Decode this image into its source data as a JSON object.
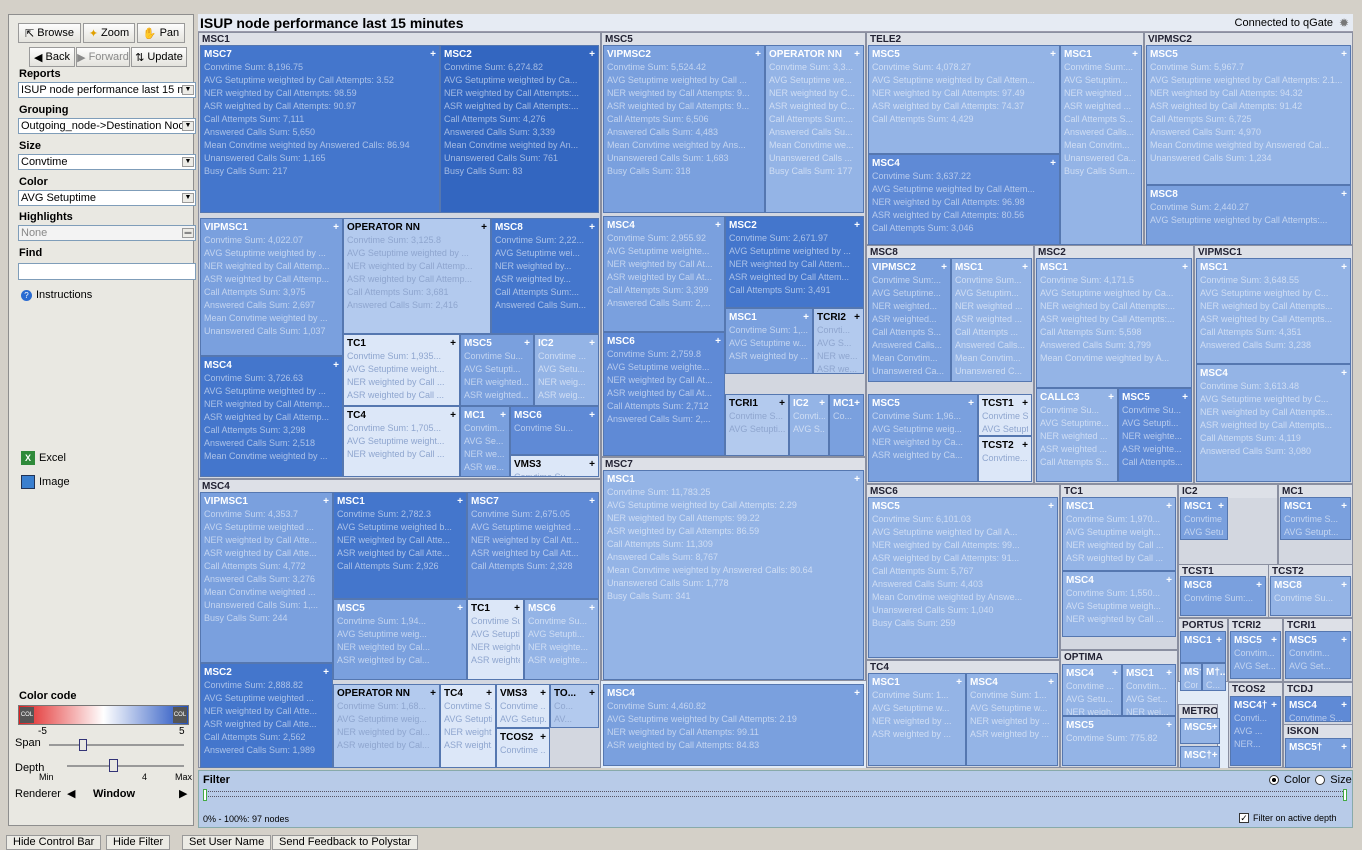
{
  "controls": {
    "browse": "Browse",
    "zoom": "Zoom",
    "pan": "Pan",
    "back": "Back",
    "forward": "Forward",
    "update": "Update",
    "reports_label": "Reports",
    "reports_value": "ISUP node performance last 15 mi",
    "grouping_label": "Grouping",
    "grouping_value": "Outgoing_node->Destination Nod",
    "size_label": "Size",
    "size_value": "Convtime",
    "color_label": "Color",
    "color_value": "AVG Setuptime",
    "highlights_label": "Highlights",
    "highlights_value": "None",
    "find_label": "Find",
    "find_value": "",
    "instructions": "Instructions",
    "excel": "Excel",
    "image": "Image",
    "color_code_label": "Color code",
    "cc_min": "-5",
    "cc_max": "5",
    "span_label": "Span",
    "depth_label": "Depth",
    "depth_min": "Min",
    "depth_val": "4",
    "depth_max": "Max",
    "renderer_label": "Renderer",
    "renderer_value": "Window"
  },
  "treemap": {
    "title": "ISUP node performance last 15 minutes",
    "connection": "Connected to qGate",
    "groups": [
      {
        "name": "MSC1"
      },
      {
        "name": "MSC5"
      },
      {
        "name": "TELE2"
      },
      {
        "name": "VIPMSC2"
      },
      {
        "name": "MSC8"
      },
      {
        "name": "MSC2"
      },
      {
        "name": "VIPMSC1"
      },
      {
        "name": "MSC7"
      },
      {
        "name": "MSC4"
      },
      {
        "name": "MSC6"
      },
      {
        "name": "TC1"
      },
      {
        "name": "IC2"
      },
      {
        "name": "MC1"
      },
      {
        "name": "TC4"
      },
      {
        "name": "OPTIMA"
      },
      {
        "name": "TCST1"
      },
      {
        "name": "TCST2"
      },
      {
        "name": "PORTUS"
      },
      {
        "name": "TCRI2"
      },
      {
        "name": "TCRI1"
      },
      {
        "name": "METRO"
      },
      {
        "name": "TCOS2"
      },
      {
        "name": "TCDJ"
      },
      {
        "name": "ISKON"
      }
    ],
    "cells": [
      {
        "name": "MSC7",
        "lines": [
          "Convtime Sum: 8,196.75",
          "AVG Setuptime weighted by Call Attempts: 3.52",
          "NER weighted by Call Attempts: 98.59",
          "ASR weighted by Call Attempts: 90.97",
          "Call Attempts Sum: 7,111",
          "Answered Calls Sum: 5,650",
          "Mean Convtime weighted by Answered Calls: 86.94",
          "Unanswered Calls Sum: 1,165",
          "Busy Calls Sum: 217"
        ]
      },
      {
        "name": "MSC2",
        "lines": [
          "Convtime Sum: 6,274.82",
          "AVG Setuptime weighted by Ca...",
          "NER weighted by Call Attempts:...",
          "ASR weighted by Call Attempts:...",
          "Call Attempts Sum: 4,276",
          "Answered Calls Sum: 3,339",
          "Mean Convtime weighted by An...",
          "Unanswered Calls Sum: 761",
          "Busy Calls Sum: 83"
        ]
      },
      {
        "name": "VIPMSC2",
        "lines": [
          "Convtime Sum: 5,524.42",
          "AVG Setuptime weighted by Call ...",
          "NER weighted by Call Attempts: 9...",
          "ASR weighted by Call Attempts: 9...",
          "Call Attempts Sum: 6,506",
          "Answered Calls Sum: 4,483",
          "Mean Convtime weighted by Ans...",
          "Unanswered Calls Sum: 1,683",
          "Busy Calls Sum: 318"
        ]
      },
      {
        "name": "OPERATOR NN",
        "lines": [
          "Convtime Sum: 3,3...",
          "AVG Setuptime we...",
          "NER weighted by C...",
          "ASR weighted by C...",
          "Call Attempts Sum:...",
          "Answered Calls Su...",
          "Mean Convtime we...",
          "Unanswered Calls ...",
          "Busy Calls Sum: 177"
        ]
      },
      {
        "name": "MSC5",
        "lines": [
          "Convtime Sum: 4,078.27",
          "AVG Setuptime weighted by Call Attem...",
          "NER weighted by Call Attempts: 97.49",
          "ASR weighted by Call Attempts: 74.37",
          "Call Attempts Sum: 4,429"
        ]
      },
      {
        "name": "MSC1",
        "lines": [
          "Convtime Sum:...",
          "AVG Setuptim...",
          "NER weighted ...",
          "ASR weighted ...",
          "Call Attempts S...",
          "Answered Calls...",
          "Mean Convtim...",
          "Unanswered Ca...",
          "Busy Calls Sum..."
        ]
      },
      {
        "name": "MSC4",
        "lines": [
          "Convtime Sum: 3,637.22",
          "AVG Setuptime weighted by Call Attem...",
          "NER weighted by Call Attempts: 96.98",
          "ASR weighted by Call Attempts: 80.56",
          "Call Attempts Sum: 3,046"
        ]
      },
      {
        "name": "MSC5",
        "lines": [
          "Convtime Sum: 5,967.7",
          "AVG Setuptime weighted by Call Attempts: 2.1...",
          "NER weighted by Call Attempts: 94.32",
          "ASR weighted by Call Attempts: 91.42",
          "Call Attempts Sum: 6,725",
          "Answered Calls Sum: 4,970",
          "Mean Convtime weighted by Answered Cal...",
          "Unanswered Calls Sum: 1,234"
        ]
      },
      {
        "name": "MSC8",
        "lines": [
          "Convtime Sum: 2,440.27",
          "AVG Setuptime weighted by Call Attempts:..."
        ]
      },
      {
        "name": "VIPMSC1",
        "lines": [
          "Convtime Sum: 4,022.07",
          "AVG Setuptime weighted by ...",
          "NER weighted by Call Attemp...",
          "ASR weighted by Call Attemp...",
          "Call Attempts Sum: 3,975",
          "Answered Calls Sum: 2,697",
          "Mean Convtime weighted by ...",
          "Unanswered Calls Sum: 1,037"
        ]
      },
      {
        "name": "OPERATOR NN",
        "lines": [
          "Convtime Sum: 3,125.8",
          "AVG Setuptime weighted by ...",
          "NER weighted by Call Attemp...",
          "ASR weighted by Call Attemp...",
          "Call Attempts Sum: 3,681",
          "Answered Calls Sum: 2,416"
        ]
      },
      {
        "name": "MSC8",
        "lines": [
          "Convtime Sum: 2,22...",
          "AVG Setuptime wei...",
          "NER weighted by...",
          "ASR weighted by...",
          "Call Attempts Sum:...",
          "Answered Calls Sum..."
        ]
      },
      {
        "name": "MSC4",
        "lines": [
          "Convtime Sum: 3,726.63",
          "AVG Setuptime weighted by ...",
          "NER weighted by Call Attemp...",
          "ASR weighted by Call Attemp...",
          "Call Attempts Sum: 3,298",
          "Answered Calls Sum: 2,518",
          "Mean Convtime weighted by ..."
        ]
      },
      {
        "name": "TC1",
        "lines": [
          "Convtime Sum: 1,935...",
          "AVG Setuptime weight...",
          "NER weighted by Call ...",
          "ASR weighted by Call ..."
        ]
      },
      {
        "name": "MSC5",
        "lines": [
          "Convtime Su...",
          "AVG Setupti...",
          "NER weighted...",
          "ASR weighted..."
        ]
      },
      {
        "name": "IC2",
        "lines": [
          "Convtime ...",
          "AVG Setu...",
          "NER weig...",
          "ASR weig..."
        ]
      },
      {
        "name": "TC4",
        "lines": [
          "Convtime Sum: 1,705...",
          "AVG Setuptime weight...",
          "NER weighted by Call ..."
        ]
      },
      {
        "name": "MC1",
        "lines": [
          "Convtim...",
          "AVG Se...",
          "NER we...",
          "ASR we..."
        ]
      },
      {
        "name": "MSC6",
        "lines": [
          "Convtime Su..."
        ]
      },
      {
        "name": "VMS3",
        "lines": [
          "Convtime Su..."
        ]
      },
      {
        "name": "MSC4",
        "lines": [
          "Convtime Sum: 2,955.92",
          "AVG Setuptime weighte...",
          "NER weighted by Call At...",
          "ASR weighted by Call At...",
          "Call Attempts Sum: 3,399",
          "Answered Calls Sum: 2,..."
        ]
      },
      {
        "name": "MSC2",
        "lines": [
          "Convtime Sum: 2,671.97",
          "AVG Setuptime weighted by ...",
          "NER weighted by Call Attem...",
          "ASR weighted by Call Attem...",
          "Call Attempts Sum: 3,491"
        ]
      },
      {
        "name": "MSC6",
        "lines": [
          "Convtime Sum: 2,759.8",
          "AVG Setuptime weighte...",
          "NER weighted by Call At...",
          "ASR weighted by Call At...",
          "Call Attempts Sum: 2,712",
          "Answered Calls Sum: 2,..."
        ]
      },
      {
        "name": "MSC1",
        "lines": [
          "Convtime Sum: 1,...",
          "AVG Setuptime w...",
          "ASR weighted by ..."
        ]
      },
      {
        "name": "TCRI2",
        "lines": [
          "Convti...",
          "AVG S...",
          "NER we...",
          "ASR we..."
        ]
      },
      {
        "name": "TCRI1",
        "lines": [
          "Convtime S...",
          "AVG Setupti..."
        ]
      },
      {
        "name": "IC2",
        "lines": [
          "Convti...",
          "AVG S..."
        ]
      },
      {
        "name": "MC1",
        "lines": [
          "Co..."
        ]
      },
      {
        "name": "MSC1",
        "lines": [
          "Convtime Sum: 11,783.25",
          "AVG Setuptime weighted by Call Attempts: 2.29",
          "NER weighted by Call Attempts: 99.22",
          "ASR weighted by Call Attempts: 86.59",
          "Call Attempts Sum: 11,309",
          "Answered Calls Sum: 8,767",
          "Mean Convtime weighted by Answered Calls: 80.64",
          "Unanswered Calls Sum: 1,778",
          "Busy Calls Sum: 341"
        ]
      },
      {
        "name": "MSC4",
        "lines": [
          "Convtime Sum: 4,460.82",
          "AVG Setuptime weighted by Call Attempts: 2.19",
          "NER weighted by Call Attempts: 99.11",
          "ASR weighted by Call Attempts: 84.83"
        ]
      },
      {
        "name": "VIPMSC2",
        "lines": [
          "Convtime Sum:...",
          "AVG Setuptime...",
          "NER weighted...",
          "ASR weighted...",
          "Call Attempts S...",
          "Answered Calls...",
          "Mean Convtim...",
          "Unanswered Ca..."
        ]
      },
      {
        "name": "MSC1",
        "lines": [
          "Convtime Sum...",
          "AVG Setuptim...",
          "NER weighted ...",
          "ASR weighted ...",
          "Call Attempts ...",
          "Answered Calls...",
          "Mean Convtim...",
          "Unanswered C..."
        ]
      },
      {
        "name": "MSC1",
        "lines": [
          "Convtime Sum: 4,171.5",
          "AVG Setuptime weighted by Ca...",
          "NER weighted by Call Attempts:...",
          "ASR weighted by Call Attempts:...",
          "Call Attempts Sum: 5,598",
          "Answered Calls Sum: 3,799",
          "Mean Convtime weighted by A..."
        ]
      },
      {
        "name": "MSC1",
        "lines": [
          "Convtime Sum: 3,648.55",
          "AVG Setuptime weighted by C...",
          "NER weighted by Call Attempts...",
          "ASR weighted by Call Attempts...",
          "Call Attempts Sum: 4,351",
          "Answered Calls Sum: 3,238"
        ]
      },
      {
        "name": "MSC4",
        "lines": [
          "Convtime Sum: 3,613.48",
          "AVG Setuptime weighted by C...",
          "NER weighted by Call Attempts...",
          "ASR weighted by Call Attempts...",
          "Call Attempts Sum: 4,119",
          "Answered Calls Sum: 3,080"
        ]
      },
      {
        "name": "MSC5",
        "lines": [
          "Convtime Sum: 1,96...",
          "AVG Setuptime weig...",
          "NER weighted by Ca...",
          "ASR weighted by Ca..."
        ]
      },
      {
        "name": "TCST1",
        "lines": [
          "Convtime Su...",
          "AVG Setupti...",
          "NER weighte..."
        ]
      },
      {
        "name": "TCST2",
        "lines": [
          "Convtime..."
        ]
      },
      {
        "name": "CALLC3",
        "lines": [
          "Convtime Su...",
          "AVG Setuptime...",
          "NER weighted ...",
          "ASR weighted ...",
          "Call Attempts S..."
        ]
      },
      {
        "name": "MSC5",
        "lines": [
          "Convtime Su...",
          "AVG Setupti...",
          "NER weighte...",
          "ASR weighte...",
          "Call Attempts..."
        ]
      },
      {
        "name": "VIPMSC1",
        "lines": [
          "Convtime Sum: 4,353.7",
          "AVG Setuptime weighted ...",
          "NER weighted by Call Atte...",
          "ASR weighted by Call Atte...",
          "Call Attempts Sum: 4,772",
          "Answered Calls Sum: 3,276",
          "Mean Convtime weighted ...",
          "Unanswered Calls Sum: 1,...",
          "Busy Calls Sum: 244"
        ]
      },
      {
        "name": "MSC1",
        "lines": [
          "Convtime Sum: 2,782.3",
          "AVG Setuptime weighted b...",
          "NER weighted by Call Atte...",
          "ASR weighted by Call Atte...",
          "Call Attempts Sum: 2,926"
        ]
      },
      {
        "name": "MSC7",
        "lines": [
          "Convtime Sum: 2,675.05",
          "AVG Setuptime weighted ...",
          "NER weighted by Call Att...",
          "ASR weighted by Call Att...",
          "Call Attempts Sum: 2,328"
        ]
      },
      {
        "name": "MSC2",
        "lines": [
          "Convtime Sum: 2,888.82",
          "AVG Setuptime weighted ...",
          "NER weighted by Call Atte...",
          "ASR weighted by Call Atte...",
          "Call Attempts Sum: 2,562",
          "Answered Calls Sum: 1,989"
        ]
      },
      {
        "name": "MSC5",
        "lines": [
          "Convtime Sum: 1,94...",
          "AVG Setuptime weig...",
          "NER weighted by Cal...",
          "ASR weighted by Cal..."
        ]
      },
      {
        "name": "TC1",
        "lines": [
          "Convtime Sum:...",
          "AVG Setuptime...",
          "NER weighted ...",
          "ASR weighted ..."
        ]
      },
      {
        "name": "MSC6",
        "lines": [
          "Convtime Su...",
          "AVG Setupti...",
          "NER weighte...",
          "ASR weighte..."
        ]
      },
      {
        "name": "OPERATOR NN",
        "lines": [
          "Convtime Sum: 1,68...",
          "AVG Setuptime weig...",
          "NER weighted by Cal...",
          "ASR weighted by Cal..."
        ]
      },
      {
        "name": "TC4",
        "lines": [
          "Convtime S...",
          "AVG Setupti...",
          "NER weight...",
          "ASR weight..."
        ]
      },
      {
        "name": "VMS3",
        "lines": [
          "Convtime ...",
          "AVG Setup...",
          "Convtime ..."
        ]
      },
      {
        "name": "TO...",
        "lines": [
          "Co...",
          "AV...",
          "NE...",
          "AS..."
        ]
      },
      {
        "name": "TCOS2",
        "lines": [
          "Convtime ..."
        ]
      },
      {
        "name": "MSC5",
        "lines": [
          "Convtime Sum: 6,101.03",
          "AVG Setuptime weighted by Call A...",
          "NER weighted by Call Attempts: 99...",
          "ASR weighted by Call Attempts: 91...",
          "Call Attempts Sum: 5,767",
          "Answered Calls Sum: 4,403",
          "Mean Convtime weighted by Answe...",
          "Unanswered Calls Sum: 1,040",
          "Busy Calls Sum: 259"
        ]
      },
      {
        "name": "MSC1",
        "lines": [
          "Convtime Sum: 1,970...",
          "AVG Setuptime weigh...",
          "NER weighted by Call ...",
          "ASR weighted by Call ..."
        ]
      },
      {
        "name": "MSC4",
        "lines": [
          "Convtime Sum: 1,550...",
          "AVG Setuptime weigh...",
          "NER weighted by Call ..."
        ]
      },
      {
        "name": "MSC4",
        "lines": [
          "Convtime ...",
          "AVG Setu...",
          "NER weigh...",
          "ASR weigh..."
        ]
      },
      {
        "name": "MSC1",
        "lines": [
          "Convtim...",
          "AVG Set...",
          "NER wei...",
          "ASR wei..."
        ]
      },
      {
        "name": "MSC5",
        "lines": [
          "Convtime Sum: 775.82"
        ]
      },
      {
        "name": "MSC1",
        "lines": [
          "Convtime Sum: 1...",
          "AVG Setuptime w...",
          "NER weighted by ...",
          "ASR weighted by ..."
        ]
      },
      {
        "name": "MSC4",
        "lines": [
          "Convtime Sum: 1...",
          "AVG Setuptime w...",
          "NER weighted by ...",
          "ASR weighted by ..."
        ]
      },
      {
        "name": "MSC1",
        "lines": [
          "Convtime Sum: 1...",
          "AVG Setuptime ..."
        ]
      },
      {
        "name": "MSC1",
        "lines": [
          "Convtime S...",
          "AVG Setupt..."
        ]
      },
      {
        "name": "MSC8",
        "lines": [
          "Convtime Sum:..."
        ]
      },
      {
        "name": "MSC8",
        "lines": [
          "Convtime Su..."
        ]
      },
      {
        "name": "MSC1",
        "lines": []
      },
      {
        "name": "MSC5",
        "lines": [
          "Convtim...",
          "AVG Set..."
        ]
      },
      {
        "name": "MSC5",
        "lines": [
          "Convtim...",
          "AVG Set..."
        ]
      },
      {
        "name": "MS†",
        "lines": [
          "Con..."
        ]
      },
      {
        "name": "M†..",
        "lines": [
          "C..."
        ]
      },
      {
        "name": "MSC5",
        "lines": []
      },
      {
        "name": "MSC†",
        "lines": []
      },
      {
        "name": "MSC4†",
        "lines": [
          "Convti...",
          "AVG ...",
          "NER..."
        ]
      },
      {
        "name": "MSC4",
        "lines": [
          "Convtime S..."
        ]
      },
      {
        "name": "MSC5†",
        "lines": []
      }
    ]
  },
  "filter": {
    "label": "Filter",
    "color_opt": "Color",
    "size_opt": "Size",
    "range_text": "0% - 100%: 97 nodes",
    "active_depth": "Filter on active depth"
  },
  "bottom": {
    "hide_control": "Hide Control Bar",
    "hide_filter": "Hide Filter",
    "set_user": "Set User Name",
    "feedback": "Send Feedback to Polystar"
  }
}
